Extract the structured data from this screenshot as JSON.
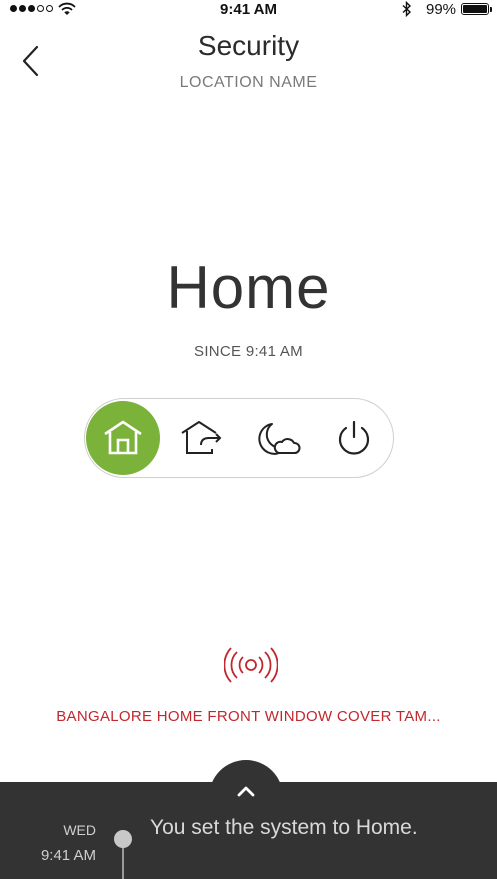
{
  "status_bar": {
    "time": "9:41 AM",
    "battery": "99%",
    "battery_level": 0.99,
    "signal_bars": 3,
    "signal_total": 5
  },
  "header": {
    "title": "Security",
    "subtitle": "LOCATION NAME",
    "back_icon": "chevron-left-icon"
  },
  "mode": {
    "name": "Home",
    "since": "SINCE 9:41 AM",
    "accent": "#7ab23a",
    "options": [
      {
        "id": "home",
        "icon": "home-icon",
        "active": true
      },
      {
        "id": "away",
        "icon": "away-icon",
        "active": false
      },
      {
        "id": "night",
        "icon": "night-icon",
        "active": false
      },
      {
        "id": "off",
        "icon": "power-icon",
        "active": false
      }
    ]
  },
  "alert": {
    "icon": "alarm-signal-icon",
    "text": "BANGALORE HOME FRONT WINDOW COVER TAM...",
    "color": "#c1272d"
  },
  "timeline": {
    "expand_icon": "chevron-up-icon",
    "day": "WED",
    "time": "9:41 AM",
    "message": "You set the system to Home."
  }
}
